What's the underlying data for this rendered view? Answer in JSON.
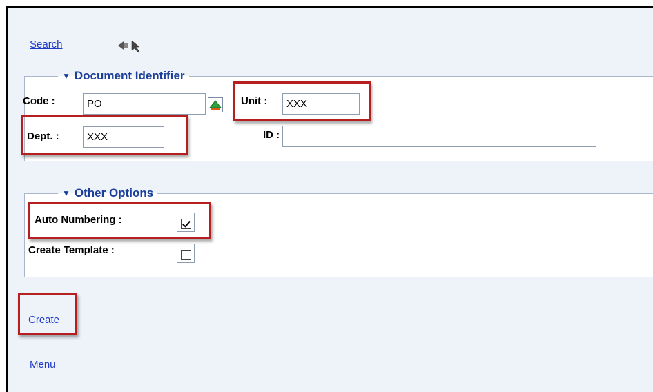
{
  "top": {
    "search_link": "Search",
    "nav_icon": "navigation-arrows-icon"
  },
  "document_identifier": {
    "legend": "Document Identifier",
    "code_label": "Code :",
    "code_value": "PO",
    "lookup_icon": "lookup-arrow-icon",
    "unit_label": "Unit :",
    "unit_value": "XXX",
    "dept_label": "Dept. :",
    "dept_value": "XXX",
    "id_label": "ID :",
    "id_value": ""
  },
  "other_options": {
    "legend": "Other Options",
    "auto_numbering_label": "Auto Numbering :",
    "auto_numbering_checked": true,
    "create_template_label": "Create Template :",
    "create_template_checked": false
  },
  "actions": {
    "create_link": "Create",
    "menu_link": "Menu"
  },
  "colors": {
    "highlight": "#b51f1f",
    "legend_text": "#1b3f9a",
    "link": "#1f39c9",
    "background": "#eef2f9"
  }
}
